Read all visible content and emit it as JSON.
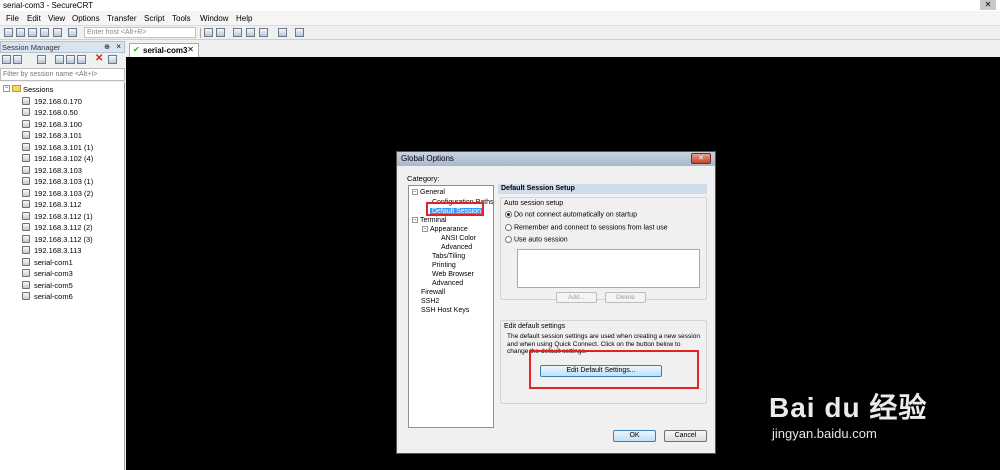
{
  "window": {
    "title": "serial-com3 - SecureCRT"
  },
  "menu": [
    "File",
    "Edit",
    "View",
    "Options",
    "Transfer",
    "Script",
    "Tools",
    "Window",
    "Help"
  ],
  "toolbar": {
    "host_placeholder": "Enter host <Alt+R>"
  },
  "session_manager": {
    "title": "Session Manager",
    "filter_placeholder": "Filter by session name <Alt+I>",
    "root": "Sessions",
    "items": [
      "192.168.0.170",
      "192.168.0.50",
      "192.168.3.100",
      "192.168.3.101",
      "192.168.3.101 (1)",
      "192.168.3.102 (4)",
      "192.168.3.103",
      "192.168.3.103 (1)",
      "192.168.3.103 (2)",
      "192.168.3.112",
      "192.168.3.112 (1)",
      "192.168.3.112 (2)",
      "192.168.3.112 (3)",
      "192.168.3.113",
      "serial-com1",
      "serial-com3",
      "serial-com5",
      "serial-com6"
    ]
  },
  "tabs": [
    {
      "label": "serial-com3",
      "active": true
    }
  ],
  "dialog": {
    "title": "Global Options",
    "category_label": "Category:",
    "categories": [
      {
        "label": "General",
        "level": 0,
        "expander": "minus"
      },
      {
        "label": "Configuration Paths",
        "level": 1
      },
      {
        "label": "Default Session",
        "level": 1,
        "selected": true
      },
      {
        "label": "Terminal",
        "level": 0,
        "expander": "minus"
      },
      {
        "label": "Appearance",
        "level": 1,
        "expander": "minus"
      },
      {
        "label": "ANSI Color",
        "level": 2
      },
      {
        "label": "Advanced",
        "level": 2
      },
      {
        "label": "Tabs/Tiling",
        "level": 1
      },
      {
        "label": "Printing",
        "level": 1
      },
      {
        "label": "Web Browser",
        "level": 1
      },
      {
        "label": "Advanced",
        "level": 1
      },
      {
        "label": "Firewall",
        "level": 0
      },
      {
        "label": "SSH2",
        "level": 0
      },
      {
        "label": "SSH Host Keys",
        "level": 0
      }
    ],
    "panel_header": "Default Session Setup",
    "auto_setup": {
      "title": "Auto session setup",
      "options": [
        {
          "label": "Do not connect automatically on startup",
          "selected": true
        },
        {
          "label": "Remember and connect to sessions from last use",
          "selected": false
        },
        {
          "label": "Use auto session",
          "selected": false
        }
      ],
      "add_label": "Add...",
      "delete_label": "Delete"
    },
    "edit_defaults": {
      "title": "Edit default settings",
      "description": "The default session settings are used when creating a new session and when using Quick Connect.  Click on the button below to change the default settings.",
      "button_label": "Edit Default Settings..."
    },
    "ok_label": "OK",
    "cancel_label": "Cancel"
  },
  "watermark": {
    "brand": "Bai du 经验",
    "url": "jingyan.baidu.com"
  },
  "colors": {
    "annotation_red": "#e52222",
    "selection_blue": "#3399ff",
    "terminal_bg": "#000000"
  }
}
